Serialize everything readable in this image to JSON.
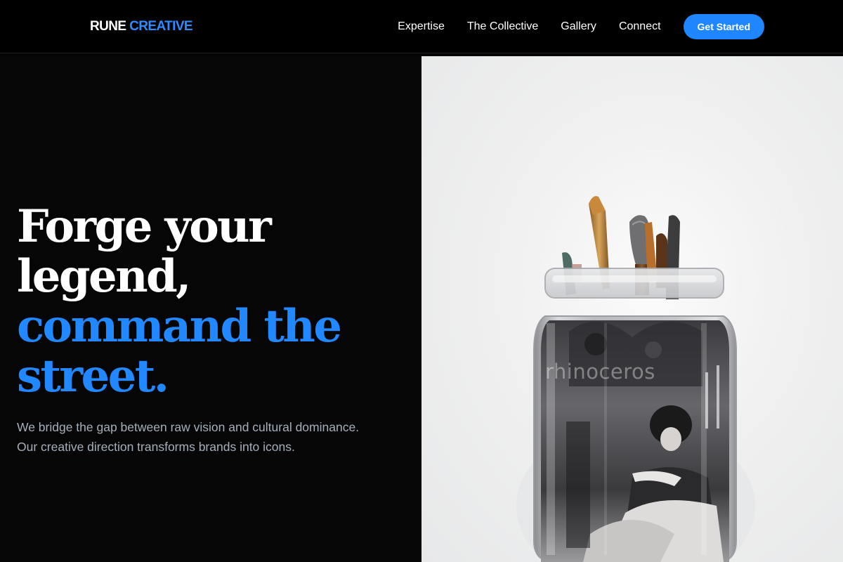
{
  "brand": {
    "name": "RUNE",
    "accent": "CREATIVE"
  },
  "nav": {
    "items": [
      "Expertise",
      "The Collective",
      "Gallery",
      "Connect"
    ],
    "cta_label": "Get Started"
  },
  "hero": {
    "headline_line1": "Forge your",
    "headline_line2": "legend,",
    "headline_line3": "command the",
    "headline_line4": "street.",
    "subtext": "We bridge the gap between raw vision and cultural dominance. Our creative direction transforms brands into icons.",
    "image_watermark": "rhinoceros"
  },
  "colors": {
    "accent": "#2288ff",
    "cta_background": "#1f86ff",
    "page_background": "#060606",
    "header_background": "#000000",
    "body_text": "#a6afbc"
  }
}
